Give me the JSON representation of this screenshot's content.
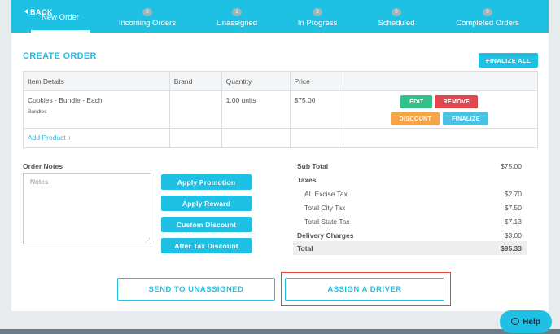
{
  "nav": {
    "back_label": "BACK",
    "tabs": [
      {
        "label": "New Order",
        "badge": ""
      },
      {
        "label": "Incoming Orders",
        "badge": "0"
      },
      {
        "label": "Unassigned",
        "badge": "1"
      },
      {
        "label": "In Progress",
        "badge": "3"
      },
      {
        "label": "Scheduled",
        "badge": "0"
      },
      {
        "label": "Completed Orders",
        "badge": "0"
      }
    ]
  },
  "order": {
    "title": "CREATE ORDER",
    "finalize_all_label": "FINALIZE ALL",
    "columns": [
      "Item Details",
      "Brand",
      "Quantity",
      "Price"
    ],
    "item": {
      "name": "Cookies - Bundle - Each",
      "category": "Bundles",
      "brand": "",
      "quantity": "1.00 units",
      "price": "$75.00",
      "actions": {
        "edit": "EDIT",
        "remove": "REMOVE",
        "discount": "DISCOUNT",
        "finalize": "FINALIZE"
      }
    },
    "add_product_label": "Add Product +"
  },
  "notes": {
    "label": "Order Notes",
    "placeholder": "Notes",
    "value": ""
  },
  "promotions": [
    "Apply Promotion",
    "Apply Reward",
    "Custom Discount",
    "After Tax Discount"
  ],
  "totals": {
    "subtotal_label": "Sub Total",
    "subtotal": "$75.00",
    "taxes_label": "Taxes",
    "taxes": [
      {
        "label": "AL Excise Tax",
        "value": "$2.70"
      },
      {
        "label": "Total City Tax",
        "value": "$7.50"
      },
      {
        "label": "Total State Tax",
        "value": "$7.13"
      }
    ],
    "delivery_label": "Delivery Charges",
    "delivery": "$3.00",
    "total_label": "Total",
    "total": "$95.33"
  },
  "actions": {
    "send_label": "SEND TO UNASSIGNED",
    "assign_label": "ASSIGN A DRIVER"
  },
  "help_label": "Help",
  "colors": {
    "accent": "#1ec1e4",
    "edit": "#2fc389",
    "remove": "#e0484e",
    "discount": "#f4a54a",
    "finalize": "#4ac2e3",
    "highlight": "#e0483a"
  }
}
